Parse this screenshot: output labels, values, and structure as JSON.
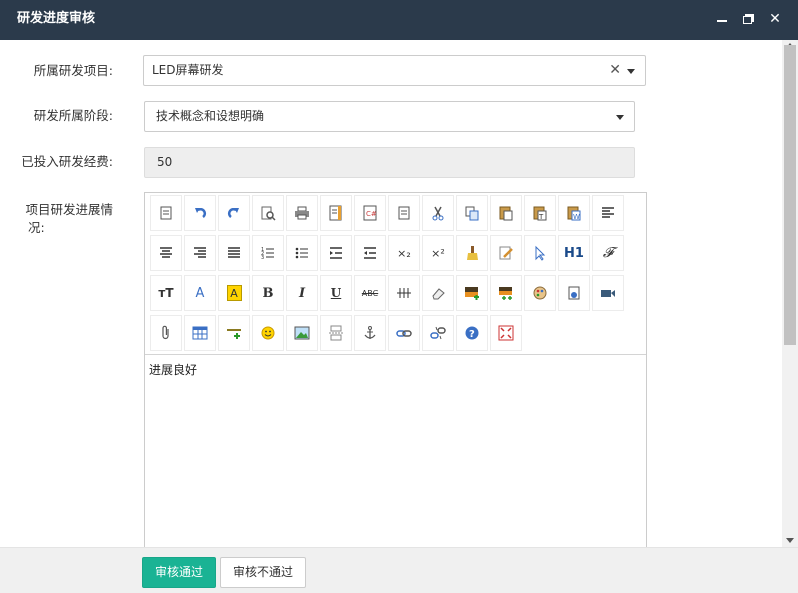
{
  "window": {
    "title": "研发进度审核"
  },
  "form": {
    "project_label": "所属研发项目:",
    "project_value": "LED屏幕研发",
    "project_clear": "✕",
    "stage_label": "研发所属阶段:",
    "stage_value": "技术概念和设想明确",
    "budget_label": "已投入研发经费:",
    "budget_value": "50",
    "progress_label_line1": "项目研发进展情",
    "progress_label_line2": "况:",
    "progress_text": "进展良好"
  },
  "toolbar": {
    "text_buttons": {
      "subscript": "×₂",
      "superscript": "×²",
      "heading": "H1",
      "fontfamily": "𝓕",
      "fontsize": "ᴛT",
      "fontcolor": "A",
      "backcolor": "A",
      "bold": "B",
      "italic": "I",
      "underline": "U",
      "strike": "ABC"
    }
  },
  "footer": {
    "approve_label": "审核通过",
    "reject_label": "审核不通过"
  },
  "colors": {
    "titlebar": "#2b3a4b",
    "approve": "#1ab394"
  }
}
